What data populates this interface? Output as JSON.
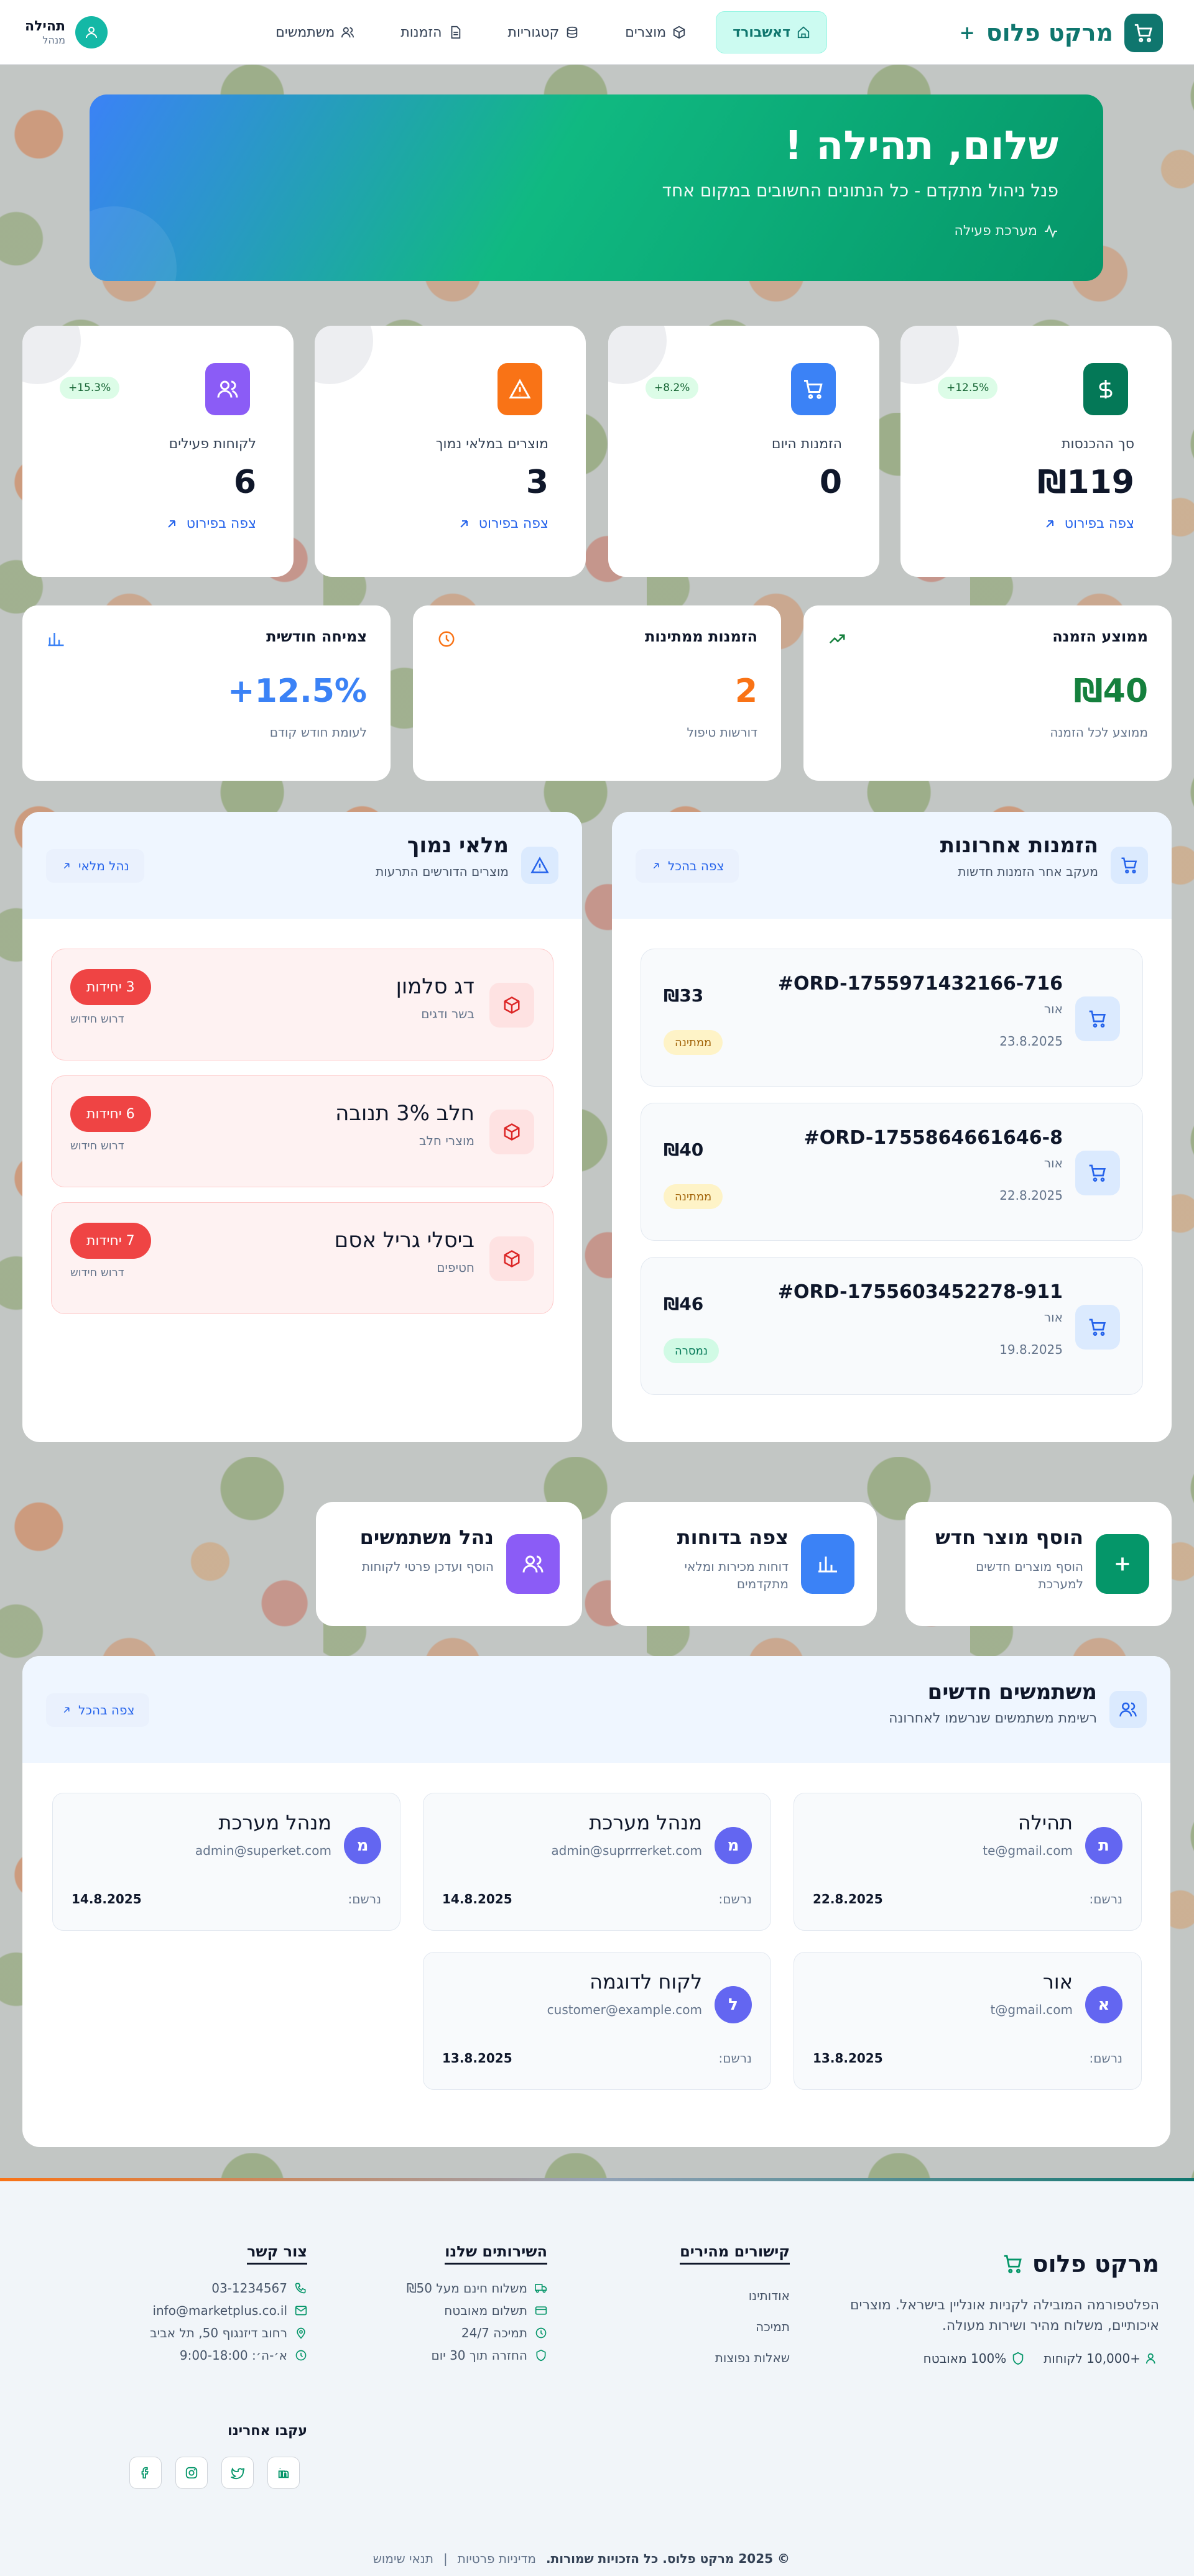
{
  "header": {
    "logo_text": "מרקט פלוס",
    "logo_plus": "+",
    "nav": [
      {
        "label": "דאשבורד",
        "icon": "home-icon",
        "active": true
      },
      {
        "label": "מוצרים",
        "icon": "package-icon",
        "active": false
      },
      {
        "label": "קטגוריות",
        "icon": "layers-icon",
        "active": false
      },
      {
        "label": "הזמנות",
        "icon": "document-icon",
        "active": false
      },
      {
        "label": "משתמשים",
        "icon": "users-icon",
        "active": false
      }
    ],
    "user": {
      "name": "תהילה",
      "role": "מנהל"
    }
  },
  "hero": {
    "title": "שלום, תהילה !",
    "subtitle": "פנל ניהול מתקדם - כל הנתונים החשובים במקום אחד",
    "status": "מערכת פעילה"
  },
  "stats": [
    {
      "label": "סך ההכנסות",
      "value": "₪119",
      "badge": "+12.5%",
      "link": "צפה בפירוט",
      "icon": "dollar-icon",
      "color": "#047857"
    },
    {
      "label": "הזמנות היום",
      "value": "0",
      "badge": "+8.2%",
      "link": "",
      "icon": "cart-icon",
      "color": "#3b82f6"
    },
    {
      "label": "מוצרים במלאי נמוך",
      "value": "3",
      "badge": "",
      "link": "צפה בפירוט",
      "icon": "alert-icon",
      "color": "#f97316"
    },
    {
      "label": "לקוחות פעילים",
      "value": "6",
      "badge": "+15.3%",
      "link": "צפה בפירוט",
      "icon": "users-icon",
      "color": "#8b5cf6"
    }
  ],
  "secondary": [
    {
      "title": "ממוצע הזמנה",
      "value": "₪40",
      "sub": "ממוצע לכל הזמנה",
      "color": "#15803d",
      "icon": "trend-up-icon"
    },
    {
      "title": "הזמנות ממתינות",
      "value": "2",
      "sub": "דורשות טיפול",
      "color": "#f97316",
      "icon": "clock-icon"
    },
    {
      "title": "צמיחה חודשית",
      "value": "+12.5%",
      "sub": "לעומת חודש קודם",
      "color": "#3b82f6",
      "icon": "bar-chart-icon"
    }
  ],
  "orders_panel": {
    "title": "הזמנות אחרונות",
    "subtitle": "מעקב אחר הזמנות חדשות",
    "button": "צפה בהכל",
    "orders": [
      {
        "id": "#ORD-1755971432166-716",
        "name": "אור",
        "date": "23.8.2025",
        "amount": "₪33",
        "status": "ממתינה",
        "status_kind": "pend"
      },
      {
        "id": "#ORD-1755864661646-8",
        "name": "אור",
        "date": "22.8.2025",
        "amount": "₪40",
        "status": "ממתינה",
        "status_kind": "pend"
      },
      {
        "id": "#ORD-1755603452278-911",
        "name": "אור",
        "date": "19.8.2025",
        "amount": "₪46",
        "status": "נמסרה",
        "status_kind": "done"
      }
    ]
  },
  "stock_panel": {
    "title": "מלאי נמוך",
    "subtitle": "מוצרים הדורשים התרעות",
    "button": "נהל מלאי",
    "items": [
      {
        "name": "דג סלמון",
        "category": "בשר ודגים",
        "units": "3 יחידות",
        "need": "דרוש חידוש"
      },
      {
        "name": "חלב 3% תנובה",
        "category": "מוצרי חלב",
        "units": "6 יחידות",
        "need": "דרוש חידוש"
      },
      {
        "name": "ביסלי גריל אסם",
        "category": "חטיפים",
        "units": "7 יחידות",
        "need": "דרוש חידוש"
      }
    ]
  },
  "quick_actions": [
    {
      "title": "הוסף מוצר חדש",
      "desc": "הוסף מוצרים חדשים למערכת",
      "icon": "plus-icon",
      "color": "#059669"
    },
    {
      "title": "צפה בדוחות",
      "desc": "דוחות מכירות ומלאי מתקדמים",
      "icon": "bar-chart-icon",
      "color": "#3b82f6"
    },
    {
      "title": "נהל משתמשים",
      "desc": "הוסף ועדכן פרטי לקוחות",
      "icon": "users-icon",
      "color": "#8b5cf6"
    }
  ],
  "users_panel": {
    "title": "משתמשים חדשים",
    "subtitle": "רשימת משתמשים שנרשמו לאחרונה",
    "button": "צפה בהכל",
    "registered_label": "נרשם:",
    "users": [
      {
        "initial": "ת",
        "name": "תהילה",
        "email": "te@gmail.com",
        "date": "22.8.2025"
      },
      {
        "initial": "מ",
        "name": "מנהל מערכת",
        "email": "admin@suprrrerket.com",
        "date": "14.8.2025"
      },
      {
        "initial": "מ",
        "name": "מנהל מערכת",
        "email": "admin@superket.com",
        "date": "14.8.2025"
      },
      {
        "initial": "א",
        "name": "אור",
        "email": "t@gmail.com",
        "date": "13.8.2025"
      },
      {
        "initial": "ל",
        "name": "לקוח לדוגמה",
        "email": "customer@example.com",
        "date": "13.8.2025"
      }
    ]
  },
  "footer": {
    "brand": "מרקט פלוס",
    "description": "הפלטפורמה המובילה לקניות אונליין בישראל. מוצרים איכותיים, משלוח מהיר ושירות מעולה.",
    "customers": "+10,000 לקוחות",
    "secure": "100% מאובטח",
    "quick_links": {
      "title": "קישורים מהירים",
      "items": [
        "אודותינו",
        "תמיכה",
        "שאלות נפוצות"
      ]
    },
    "services": {
      "title": "השירותים שלנו",
      "items": [
        "משלוח חינם מעל ₪50",
        "תשלום מאובטח",
        "תמיכה 24/7",
        "החזרה תוך 30 יום"
      ]
    },
    "contact": {
      "title": "צור קשר",
      "items": [
        "03-1234567",
        "info@marketplus.co.il",
        "רחוב דיזנגוף 50, תל אביב",
        "א׳-ה׳: 9:00-18:00"
      ]
    },
    "follow": "עקבו אחרינו",
    "copyright": "© 2025 מרקט פלוס. כל הזכויות שמורות.",
    "privacy": "מדיניות פרטיות",
    "terms": "תנאי שימוש"
  }
}
